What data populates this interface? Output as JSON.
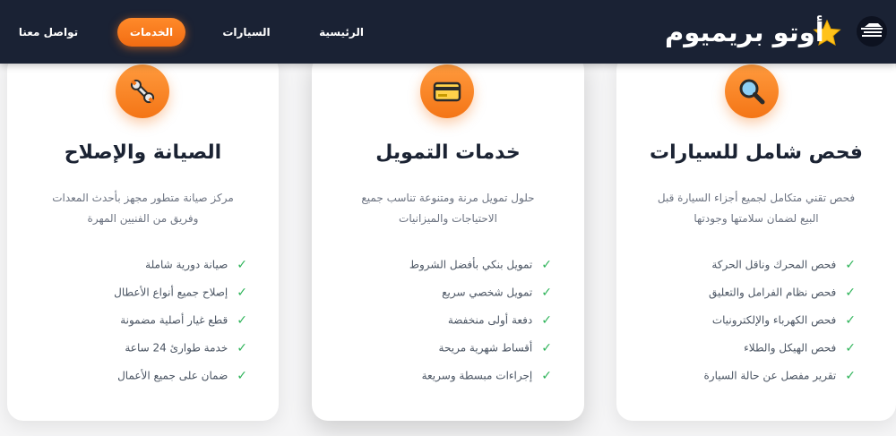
{
  "brand": {
    "name": "أوتو بريميوم"
  },
  "nav": {
    "home": "الرئيسية",
    "cars": "السيارات",
    "services": "الخدمات",
    "contact": "تواصل معنا"
  },
  "colors": {
    "nav_bg": "#1a2234",
    "accent": "#f47516",
    "check": "#2fb45a",
    "title": "#1b2333"
  },
  "cards": [
    {
      "icon": "magnifier-icon",
      "title": "فحص شامل للسيارات",
      "description": "فحص تقني متكامل لجميع أجزاء السيارة قبل البيع لضمان سلامتها وجودتها",
      "features": [
        "فحص المحرك وناقل الحركة",
        "فحص نظام الفرامل والتعليق",
        "فحص الكهرباء والإلكترونيات",
        "فحص الهيكل والطلاء",
        "تقرير مفصل عن حالة السيارة"
      ]
    },
    {
      "icon": "credit-card-icon",
      "title": "خدمات التمويل",
      "description": "حلول تمويل مرنة ومتنوعة تناسب جميع الاحتياجات والميزانيات",
      "features": [
        "تمويل بنكي بأفضل الشروط",
        "تمويل شخصي سريع",
        "دفعة أولى منخفضة",
        "أقساط شهرية مريحة",
        "إجراءات مبسطة وسريعة"
      ]
    },
    {
      "icon": "wrench-icon",
      "title": "الصيانة والإصلاح",
      "description": "مركز صيانة متطور مجهز بأحدث المعدات وفريق من الفنيين المهرة",
      "features": [
        "صيانة دورية شاملة",
        "إصلاح جميع أنواع الأعطال",
        "قطع غيار أصلية مضمونة",
        "خدمة طوارئ 24 ساعة",
        "ضمان على جميع الأعمال"
      ]
    }
  ]
}
